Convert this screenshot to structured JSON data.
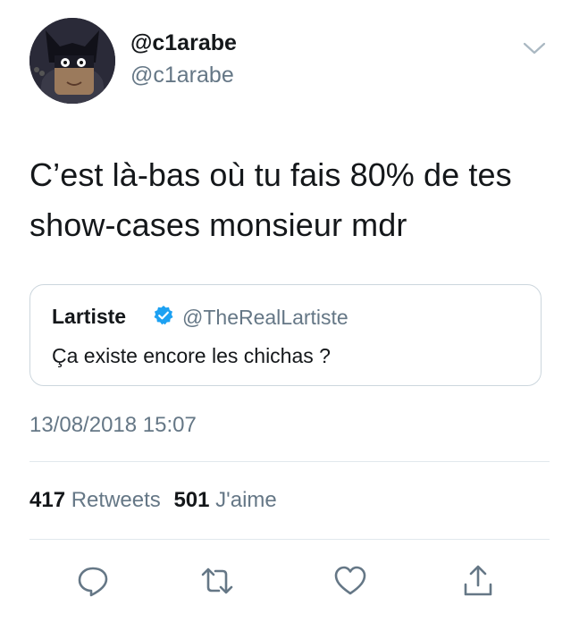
{
  "user": {
    "display_name": "@c1arabe",
    "handle": "@c1arabe",
    "avatar": "avatar-cartoon-icon"
  },
  "tweet": {
    "text_line1": "C’est là-bas où tu fais 80% de tes",
    "text_line2": "show-cases monsieur mdr",
    "timestamp": "13/08/2018 15:07"
  },
  "quoted_tweet": {
    "name": "Lartiste",
    "verified": true,
    "handle": "@TheRealLartiste",
    "text": "Ça existe encore les chichas ?"
  },
  "stats": {
    "retweets_count": "417",
    "retweets_label": "Retweets",
    "likes_count": "501",
    "likes_label": "J'aime"
  },
  "actions": [
    "reply-icon",
    "retweet-icon",
    "like-icon",
    "share-icon"
  ],
  "colors": {
    "text": "#14171a",
    "secondary": "#657786",
    "verified": "#1da1f2",
    "divider": "#e1e8ed"
  }
}
